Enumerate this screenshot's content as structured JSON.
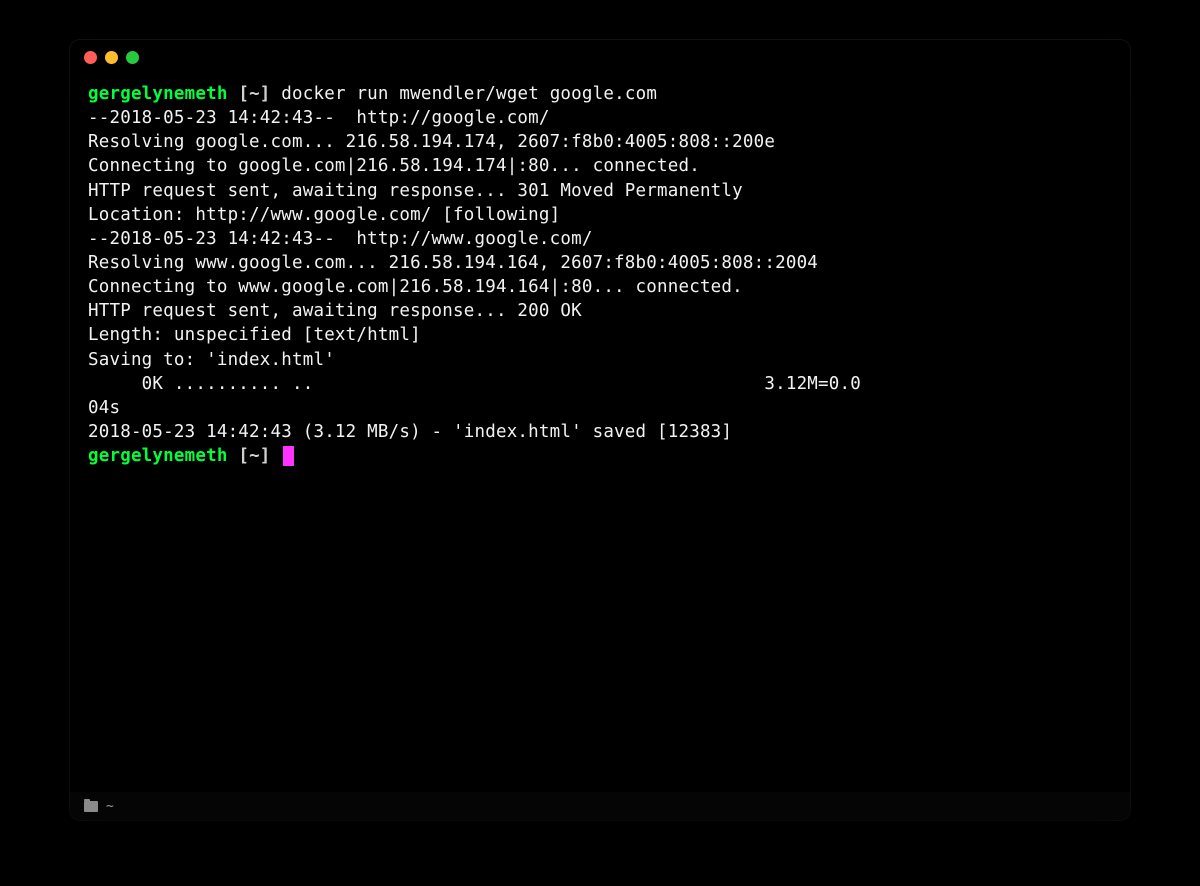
{
  "window": {
    "traffic_lights": {
      "close": "#ff5f56",
      "minimize": "#ffbd2e",
      "zoom": "#27c93f"
    }
  },
  "prompt1": {
    "user": "gergelynemeth",
    "path": "[~]",
    "command": "docker run mwendler/wget google.com"
  },
  "output": {
    "l1": "--2018-05-23 14:42:43--  http://google.com/",
    "l2": "Resolving google.com... 216.58.194.174, 2607:f8b0:4005:808::200e",
    "l3": "Connecting to google.com|216.58.194.174|:80... connected.",
    "l4": "HTTP request sent, awaiting response... 301 Moved Permanently",
    "l5": "Location: http://www.google.com/ [following]",
    "l6": "--2018-05-23 14:42:43--  http://www.google.com/",
    "l7": "Resolving www.google.com... 216.58.194.164, 2607:f8b0:4005:808::2004",
    "l8": "Connecting to www.google.com|216.58.194.164|:80... connected.",
    "l9": "HTTP request sent, awaiting response... 200 OK",
    "l10": "Length: unspecified [text/html]",
    "l11": "Saving to: 'index.html'",
    "l12": "",
    "l13": "     0K .......... ..                                          3.12M=0.0",
    "l14": "04s",
    "l15": "",
    "l16": "2018-05-23 14:42:43 (3.12 MB/s) - 'index.html' saved [12383]",
    "l17": ""
  },
  "prompt2": {
    "user": "gergelynemeth",
    "path": "[~]"
  },
  "statusbar": {
    "cwd": "~"
  }
}
